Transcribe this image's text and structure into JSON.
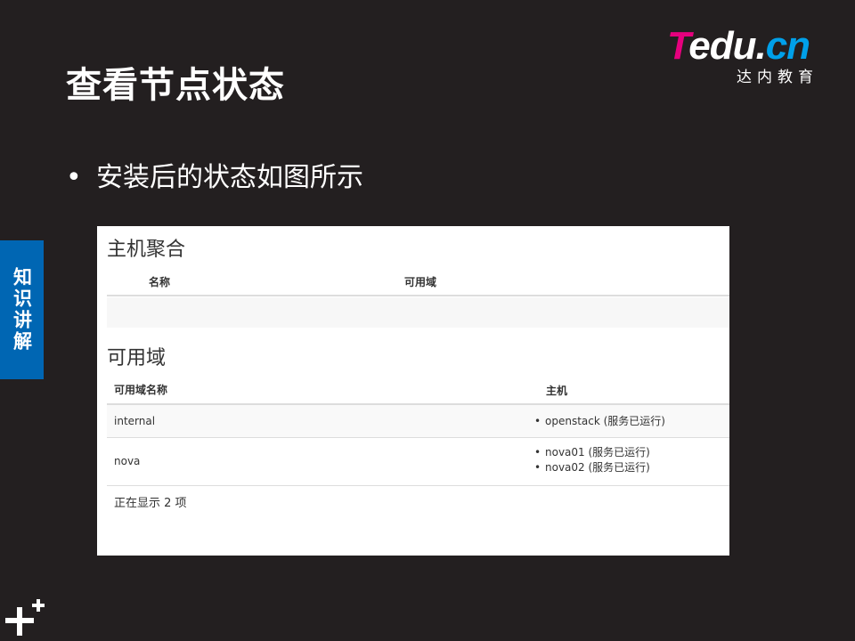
{
  "slide": {
    "title": "查看节点状态",
    "bullet": "安装后的状态如图所示",
    "side_tab": "知识讲解"
  },
  "logo": {
    "t": "T",
    "word": "edu.",
    "cn": "cn",
    "sub": "达内教育"
  },
  "colors": {
    "background": "#231f20",
    "side_tab": "#0066b3",
    "logo_pink": "#e6007e",
    "logo_blue": "#00a0e9"
  },
  "panel": {
    "host_aggregates": {
      "title": "主机聚合",
      "col_name": "名称",
      "col_zone": "可用域"
    },
    "availability_zones": {
      "title": "可用域",
      "col_zone_name": "可用域名称",
      "col_hosts": "主机",
      "rows": [
        {
          "zone": "internal",
          "hosts": [
            "openstack (服务已运行)"
          ]
        },
        {
          "zone": "nova",
          "hosts": [
            "nova01 (服务已运行)",
            "nova02 (服务已运行)"
          ]
        }
      ],
      "footer": "正在显示 2 项"
    }
  },
  "icons": {
    "bottom_left": "plus-plus-icon"
  }
}
